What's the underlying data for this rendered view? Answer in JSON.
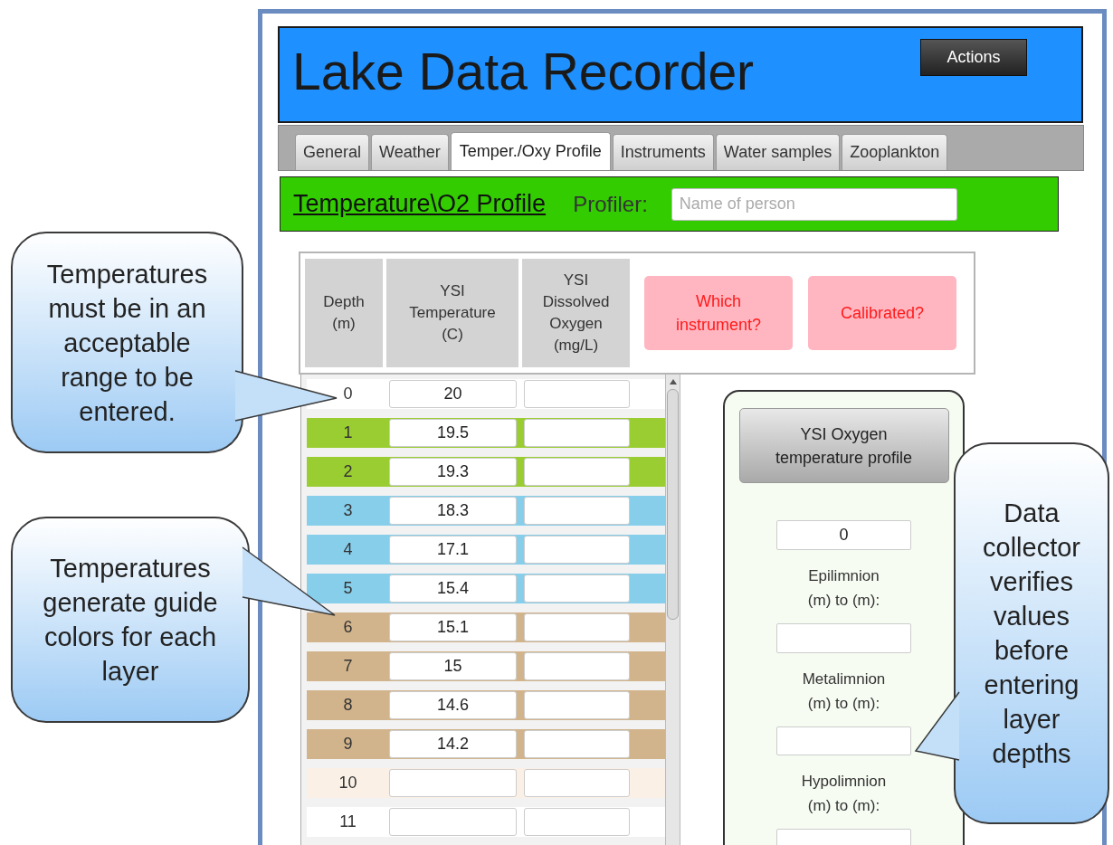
{
  "header": {
    "title": "Lake Data Recorder",
    "actions_button": "Actions"
  },
  "tabs": [
    {
      "label": "General",
      "selected": false
    },
    {
      "label": "Weather",
      "selected": false
    },
    {
      "label": "Temper./Oxy Profile",
      "selected": true
    },
    {
      "label": "Instruments",
      "selected": false
    },
    {
      "label": "Water samples",
      "selected": false
    },
    {
      "label": "Zooplankton",
      "selected": false
    }
  ],
  "section": {
    "title": "Temperature\\O2 Profile",
    "profiler_label": "Profiler:",
    "profiler_placeholder": "Name of person"
  },
  "table": {
    "columns": [
      [
        "Depth",
        "(m)"
      ],
      [
        "YSI",
        "Temperature",
        "(C)"
      ],
      [
        "YSI",
        "Dissolved",
        "Oxygen",
        "(mg/L)"
      ]
    ],
    "buttons": [
      [
        "Which",
        "instrument?"
      ],
      [
        "Calibrated?"
      ]
    ],
    "rows": [
      {
        "depth": "0",
        "temperature": "20"
      },
      {
        "depth": "1",
        "temperature": "19.5",
        "color": "#9acd32"
      },
      {
        "depth": "2",
        "temperature": "19.3",
        "color": "#9acd32"
      },
      {
        "depth": "3",
        "temperature": "18.3",
        "color": "#87ceeb"
      },
      {
        "depth": "4",
        "temperature": "17.1",
        "color": "#87ceeb"
      },
      {
        "depth": "5",
        "temperature": "15.4",
        "color": "#87ceeb"
      },
      {
        "depth": "6",
        "temperature": "15.1",
        "color": "#d2b48c"
      },
      {
        "depth": "7",
        "temperature": "15",
        "color": "#d2b48c"
      },
      {
        "depth": "8",
        "temperature": "14.6",
        "color": "#d2b48c"
      },
      {
        "depth": "9",
        "temperature": "14.2",
        "color": "#d2b48c"
      },
      {
        "depth": "10",
        "color": "#faf0e6"
      },
      {
        "depth": "11"
      }
    ]
  },
  "layers_panel": {
    "button": [
      "YSI Oxygen",
      "temperature profile"
    ],
    "start_value": "0",
    "layers": [
      {
        "label": [
          "Epilimnion",
          "(m) to (m):"
        ]
      },
      {
        "label": [
          "Metalimnion",
          "(m) to (m):"
        ]
      },
      {
        "label": [
          "Hypolimnion",
          "(m) to (m):"
        ]
      }
    ]
  },
  "callouts": [
    {
      "lines": [
        "Temperatures",
        "must be in an",
        "acceptable",
        "range to be",
        "entered."
      ]
    },
    {
      "lines": [
        "Temperatures",
        "generate guide",
        "colors for each",
        "layer"
      ]
    },
    {
      "lines": [
        "Data",
        "collector",
        "verifies",
        "values",
        "before",
        "entering",
        "layer",
        "depths"
      ]
    }
  ]
}
